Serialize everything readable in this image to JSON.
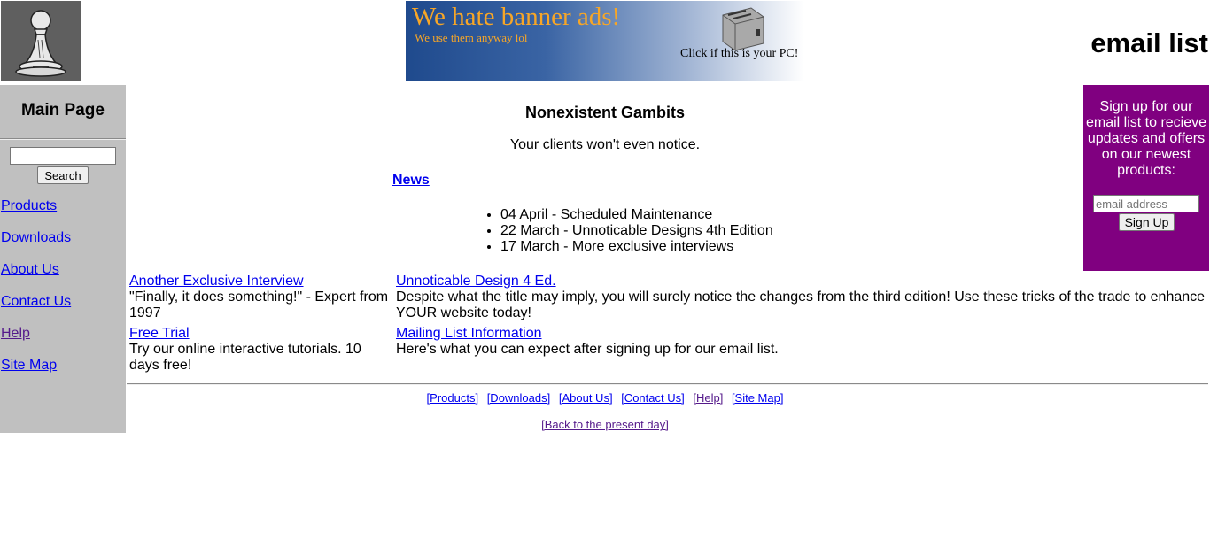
{
  "header": {
    "banner": {
      "title": "We hate banner ads!",
      "subtitle": "We use them anyway lol",
      "cta": "Click if this is your PC!",
      "colors": {
        "text": "#f7a627",
        "gradient_start": "#1f4a8d",
        "gradient_end": "#ffffff"
      }
    },
    "email_heading": "email list"
  },
  "sidebar": {
    "title": "Main Page",
    "search": {
      "value": "",
      "button_label": "Search"
    },
    "nav": [
      {
        "label": "Products"
      },
      {
        "label": "Downloads"
      },
      {
        "label": "About Us"
      },
      {
        "label": "Contact Us"
      },
      {
        "label": "Help",
        "visited": true
      },
      {
        "label": "Site Map"
      }
    ],
    "background": "#c0c0c0"
  },
  "main": {
    "title": "Nonexistent Gambits",
    "tagline": "Your clients won't even notice.",
    "news_label": "News",
    "news_items": [
      "04 April - Scheduled Maintenance",
      "22 March - Unnoticable Designs 4th Edition",
      "17 March - More exclusive interviews"
    ],
    "left_column": [
      {
        "link": "Another Exclusive Interview",
        "text": "\"Finally, it does something!\" - Expert from 1997"
      },
      {
        "link": "Free Trial",
        "text": "Try our online interactive tutorials. 10 days free!"
      }
    ],
    "right_column": [
      {
        "link": "Unnoticable Design 4 Ed.",
        "text": "Despite what the title may imply, you will surely notice the changes from the third edition! Use these tricks of the trade to enhance YOUR website today!"
      },
      {
        "link": "Mailing List Information",
        "text": "Here's what you can expect after signing up for our email list."
      }
    ]
  },
  "signup": {
    "text": "Sign up for our email list to recieve updates and offers on our newest products:",
    "placeholder": "email address",
    "button_label": "Sign Up",
    "background": "#800080"
  },
  "footer": {
    "links": [
      "[Products]",
      "[Downloads]",
      "[About Us]",
      "[Contact Us]",
      "[Help]",
      "[Site Map]"
    ],
    "back_link": "[Back to the present day]"
  }
}
